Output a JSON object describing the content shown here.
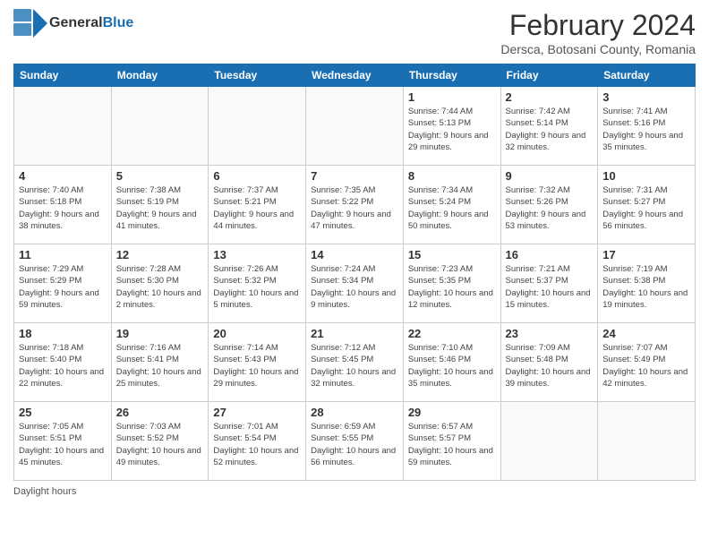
{
  "header": {
    "logo_general": "General",
    "logo_blue": "Blue",
    "month_title": "February 2024",
    "location": "Dersca, Botosani County, Romania"
  },
  "footer": {
    "daylight_label": "Daylight hours"
  },
  "days_of_week": [
    "Sunday",
    "Monday",
    "Tuesday",
    "Wednesday",
    "Thursday",
    "Friday",
    "Saturday"
  ],
  "weeks": [
    [
      {
        "day": "",
        "info": ""
      },
      {
        "day": "",
        "info": ""
      },
      {
        "day": "",
        "info": ""
      },
      {
        "day": "",
        "info": ""
      },
      {
        "day": "1",
        "info": "Sunrise: 7:44 AM\nSunset: 5:13 PM\nDaylight: 9 hours and 29 minutes."
      },
      {
        "day": "2",
        "info": "Sunrise: 7:42 AM\nSunset: 5:14 PM\nDaylight: 9 hours and 32 minutes."
      },
      {
        "day": "3",
        "info": "Sunrise: 7:41 AM\nSunset: 5:16 PM\nDaylight: 9 hours and 35 minutes."
      }
    ],
    [
      {
        "day": "4",
        "info": "Sunrise: 7:40 AM\nSunset: 5:18 PM\nDaylight: 9 hours and 38 minutes."
      },
      {
        "day": "5",
        "info": "Sunrise: 7:38 AM\nSunset: 5:19 PM\nDaylight: 9 hours and 41 minutes."
      },
      {
        "day": "6",
        "info": "Sunrise: 7:37 AM\nSunset: 5:21 PM\nDaylight: 9 hours and 44 minutes."
      },
      {
        "day": "7",
        "info": "Sunrise: 7:35 AM\nSunset: 5:22 PM\nDaylight: 9 hours and 47 minutes."
      },
      {
        "day": "8",
        "info": "Sunrise: 7:34 AM\nSunset: 5:24 PM\nDaylight: 9 hours and 50 minutes."
      },
      {
        "day": "9",
        "info": "Sunrise: 7:32 AM\nSunset: 5:26 PM\nDaylight: 9 hours and 53 minutes."
      },
      {
        "day": "10",
        "info": "Sunrise: 7:31 AM\nSunset: 5:27 PM\nDaylight: 9 hours and 56 minutes."
      }
    ],
    [
      {
        "day": "11",
        "info": "Sunrise: 7:29 AM\nSunset: 5:29 PM\nDaylight: 9 hours and 59 minutes."
      },
      {
        "day": "12",
        "info": "Sunrise: 7:28 AM\nSunset: 5:30 PM\nDaylight: 10 hours and 2 minutes."
      },
      {
        "day": "13",
        "info": "Sunrise: 7:26 AM\nSunset: 5:32 PM\nDaylight: 10 hours and 5 minutes."
      },
      {
        "day": "14",
        "info": "Sunrise: 7:24 AM\nSunset: 5:34 PM\nDaylight: 10 hours and 9 minutes."
      },
      {
        "day": "15",
        "info": "Sunrise: 7:23 AM\nSunset: 5:35 PM\nDaylight: 10 hours and 12 minutes."
      },
      {
        "day": "16",
        "info": "Sunrise: 7:21 AM\nSunset: 5:37 PM\nDaylight: 10 hours and 15 minutes."
      },
      {
        "day": "17",
        "info": "Sunrise: 7:19 AM\nSunset: 5:38 PM\nDaylight: 10 hours and 19 minutes."
      }
    ],
    [
      {
        "day": "18",
        "info": "Sunrise: 7:18 AM\nSunset: 5:40 PM\nDaylight: 10 hours and 22 minutes."
      },
      {
        "day": "19",
        "info": "Sunrise: 7:16 AM\nSunset: 5:41 PM\nDaylight: 10 hours and 25 minutes."
      },
      {
        "day": "20",
        "info": "Sunrise: 7:14 AM\nSunset: 5:43 PM\nDaylight: 10 hours and 29 minutes."
      },
      {
        "day": "21",
        "info": "Sunrise: 7:12 AM\nSunset: 5:45 PM\nDaylight: 10 hours and 32 minutes."
      },
      {
        "day": "22",
        "info": "Sunrise: 7:10 AM\nSunset: 5:46 PM\nDaylight: 10 hours and 35 minutes."
      },
      {
        "day": "23",
        "info": "Sunrise: 7:09 AM\nSunset: 5:48 PM\nDaylight: 10 hours and 39 minutes."
      },
      {
        "day": "24",
        "info": "Sunrise: 7:07 AM\nSunset: 5:49 PM\nDaylight: 10 hours and 42 minutes."
      }
    ],
    [
      {
        "day": "25",
        "info": "Sunrise: 7:05 AM\nSunset: 5:51 PM\nDaylight: 10 hours and 45 minutes."
      },
      {
        "day": "26",
        "info": "Sunrise: 7:03 AM\nSunset: 5:52 PM\nDaylight: 10 hours and 49 minutes."
      },
      {
        "day": "27",
        "info": "Sunrise: 7:01 AM\nSunset: 5:54 PM\nDaylight: 10 hours and 52 minutes."
      },
      {
        "day": "28",
        "info": "Sunrise: 6:59 AM\nSunset: 5:55 PM\nDaylight: 10 hours and 56 minutes."
      },
      {
        "day": "29",
        "info": "Sunrise: 6:57 AM\nSunset: 5:57 PM\nDaylight: 10 hours and 59 minutes."
      },
      {
        "day": "",
        "info": ""
      },
      {
        "day": "",
        "info": ""
      }
    ]
  ]
}
